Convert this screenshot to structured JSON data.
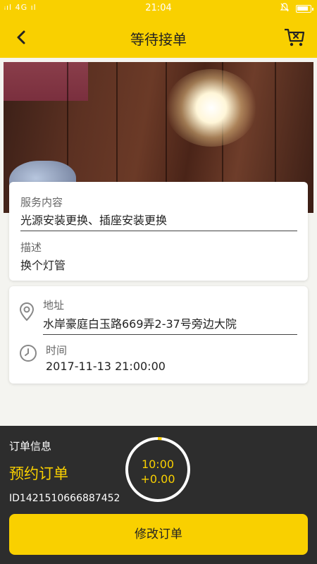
{
  "status_bar": {
    "signal_text": "ᵀᴸˡ 4G ᵀᴸˡ",
    "time": "21:04",
    "icons": [
      "signal-icon",
      "notification-muted-icon",
      "battery-icon"
    ]
  },
  "header": {
    "title": "等待接单",
    "back_icon": "back-arrow-icon",
    "cancel_icon": "cart-cancel-icon",
    "accent_color": "#f9d000"
  },
  "service": {
    "content_label": "服务内容",
    "content_value": "光源安装更换、插座安装更换",
    "desc_label": "描述",
    "desc_value": "换个灯管"
  },
  "location": {
    "address_label": "地址",
    "address_value": "水岸豪庭白玉路669弄2-37号旁边大院",
    "time_label": "时间",
    "time_value": "2017-11-13 21:00:00"
  },
  "order": {
    "info_label": "订单信息",
    "type": "预约订单",
    "id": "ID1421510666887452",
    "timer_time": "10:00",
    "timer_price": "+0.00",
    "timer_progress": 0.02,
    "modify_button": "修改订单"
  }
}
